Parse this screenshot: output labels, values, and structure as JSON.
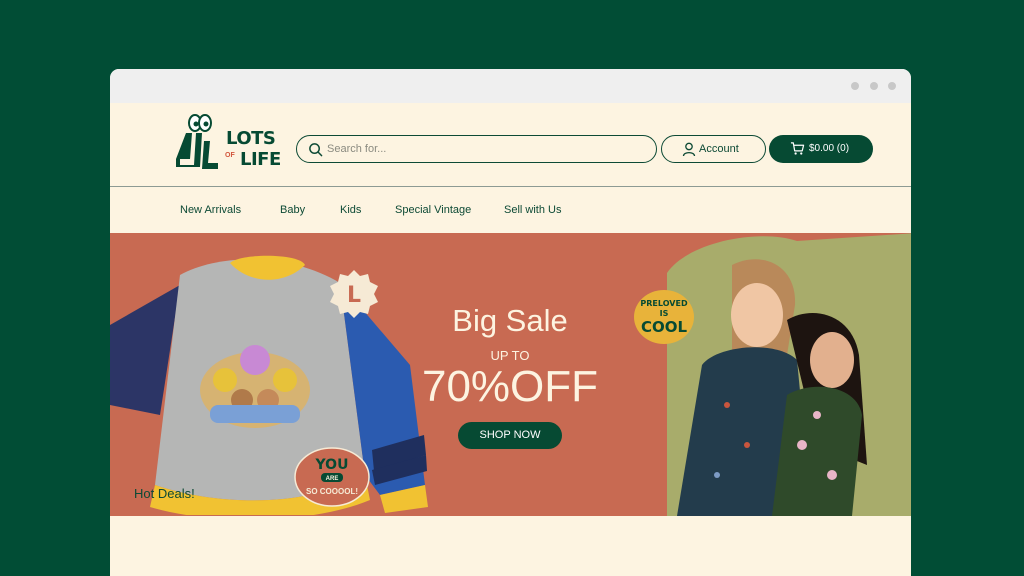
{
  "brand": {
    "logo_line1": "LOTS",
    "logo_of": "OF",
    "logo_line2": "LIFE"
  },
  "header": {
    "search_placeholder": "Search for...",
    "account_label": "Account",
    "cart_label": "$0.00 (0)"
  },
  "nav": {
    "items": [
      "New Arrivals",
      "Baby",
      "Kids",
      "Special Vintage",
      "Sell with Us"
    ]
  },
  "hero": {
    "title": "Big Sale",
    "subtitle": "UP TO",
    "discount": "70%OFF",
    "cta": "SHOP NOW",
    "sticker_preloved_1": "PRELOVED",
    "sticker_preloved_2": "IS",
    "sticker_preloved_3": "COOL",
    "sticker_you_1": "YOU",
    "sticker_you_2": "ARE",
    "sticker_you_3": "SO COOOOL!",
    "size_badge": "L"
  },
  "section": {
    "hot_deals": "Hot Deals!"
  },
  "colors": {
    "background": "#014d35",
    "page": "#fdf4e1",
    "brand_green": "#064a33",
    "hero_terracotta": "#c86a52",
    "hero_olive": "#a8ac6b"
  },
  "icons": {
    "search": "search-icon",
    "account": "user-icon",
    "cart": "cart-icon"
  }
}
